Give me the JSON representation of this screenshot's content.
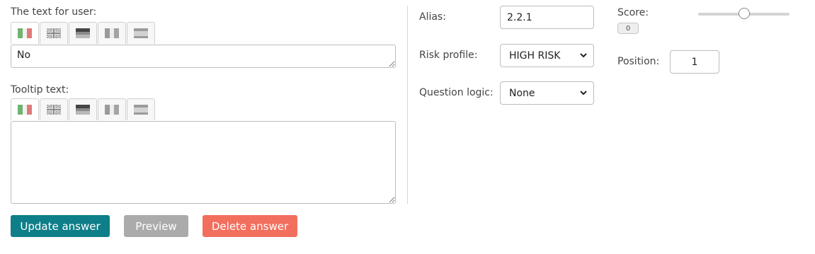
{
  "text_section": {
    "label": "The text for user:",
    "value": "No"
  },
  "tooltip_section": {
    "label": "Tooltip text:",
    "value": ""
  },
  "flag_tabs": [
    {
      "icon": "italian-flag-icon"
    },
    {
      "icon": "uk-flag-icon"
    },
    {
      "icon": "german-flag-icon"
    },
    {
      "icon": "french-flag-icon"
    },
    {
      "icon": "spanish-flag-icon"
    }
  ],
  "alias": {
    "label": "Alias:",
    "value": "2.2.1"
  },
  "risk_profile": {
    "label": "Risk profile:",
    "value": "HIGH RISK"
  },
  "question_logic": {
    "label": "Question logic:",
    "value": "None"
  },
  "score": {
    "label": "Score:",
    "value": "0",
    "slider_fraction": 0.5
  },
  "position": {
    "label": "Position:",
    "value": "1"
  },
  "buttons": {
    "update": "Update answer",
    "preview": "Preview",
    "delete": "Delete answer"
  },
  "colors": {
    "update_bg": "#0e7e88",
    "preview_bg": "#ababab",
    "delete_bg": "#f26f5e"
  }
}
